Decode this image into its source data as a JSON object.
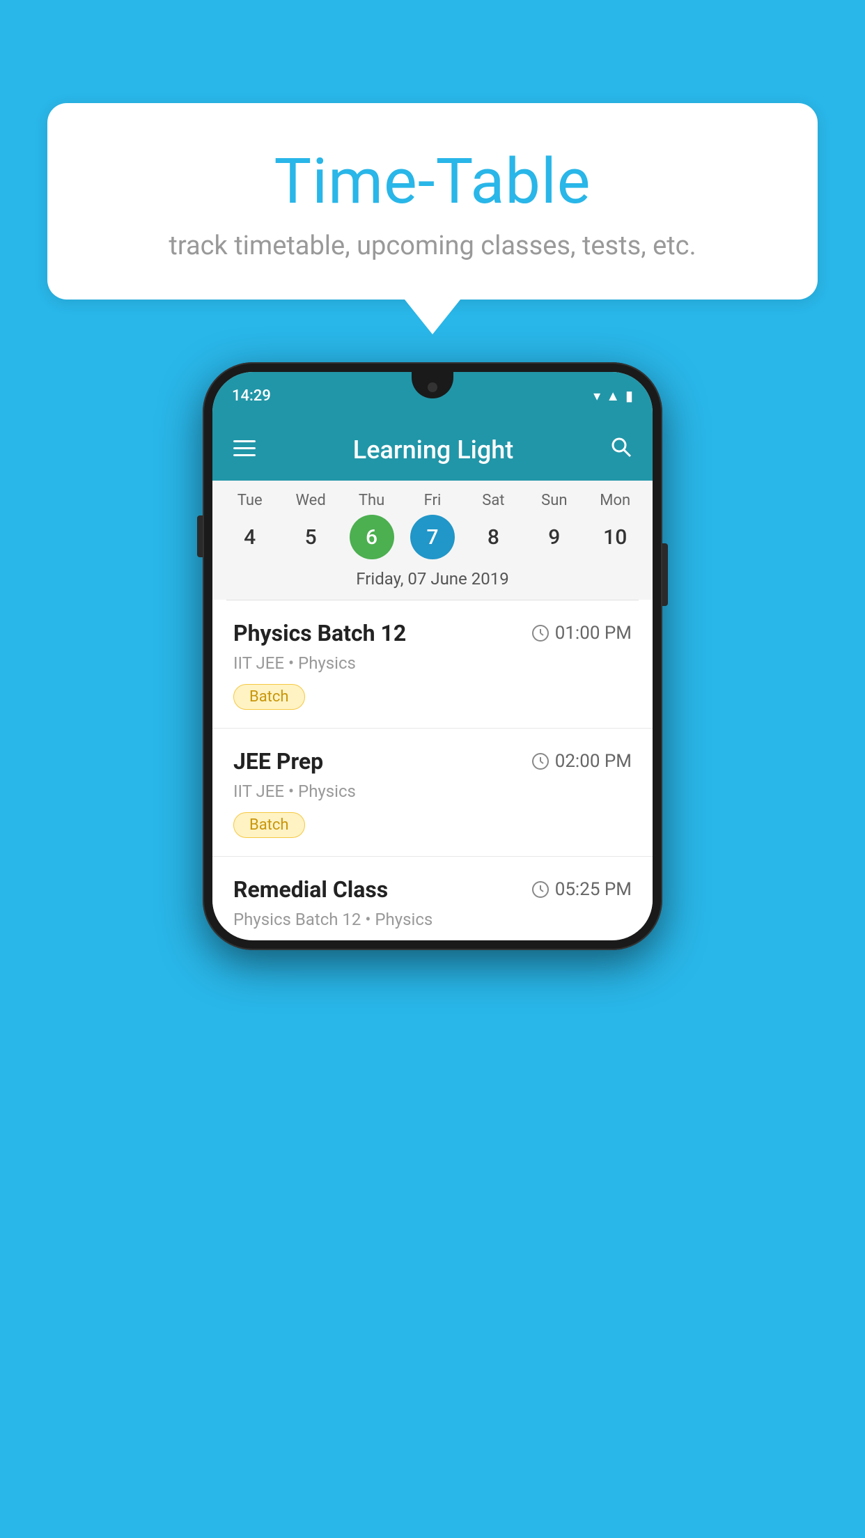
{
  "background_color": "#29B6E8",
  "speech_bubble": {
    "title": "Time-Table",
    "subtitle": "track timetable, upcoming classes, tests, etc."
  },
  "phone": {
    "status_bar": {
      "time": "14:29"
    },
    "toolbar": {
      "title": "Learning Light"
    },
    "calendar": {
      "days": [
        {
          "name": "Tue",
          "num": "4",
          "state": "normal"
        },
        {
          "name": "Wed",
          "num": "5",
          "state": "normal"
        },
        {
          "name": "Thu",
          "num": "6",
          "state": "today"
        },
        {
          "name": "Fri",
          "num": "7",
          "state": "selected"
        },
        {
          "name": "Sat",
          "num": "8",
          "state": "normal"
        },
        {
          "name": "Sun",
          "num": "9",
          "state": "normal"
        },
        {
          "name": "Mon",
          "num": "10",
          "state": "normal"
        }
      ],
      "selected_date_label": "Friday, 07 June 2019"
    },
    "schedule_items": [
      {
        "title": "Physics Batch 12",
        "time": "01:00 PM",
        "subtitle": "IIT JEE • Physics",
        "badge": "Batch"
      },
      {
        "title": "JEE Prep",
        "time": "02:00 PM",
        "subtitle": "IIT JEE • Physics",
        "badge": "Batch"
      },
      {
        "title": "Remedial Class",
        "time": "05:25 PM",
        "subtitle": "Physics Batch 12 • Physics",
        "badge": null
      }
    ]
  }
}
